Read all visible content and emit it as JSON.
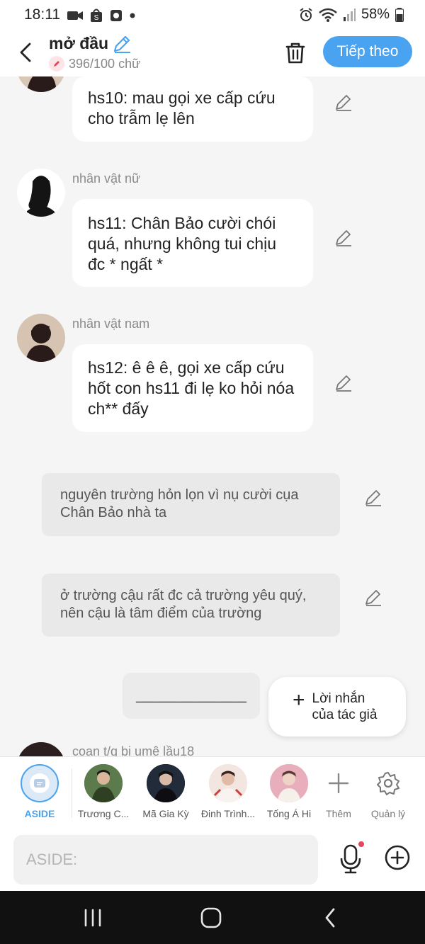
{
  "status_bar": {
    "time": "18:11",
    "battery": "58%"
  },
  "header": {
    "title": "mở đầu",
    "char_count": "396/100 chữ",
    "next_label": "Tiếp theo"
  },
  "messages": [
    {
      "speaker": "",
      "text": "hs10: mau gọi xe cấp cứu cho trẫm lẹ lên"
    },
    {
      "speaker": "nhân vật nữ",
      "text": "hs11: Chân Bảo cười chói quá, nhưng không tui chịu đc * ngất *"
    },
    {
      "speaker": "nhân vật nam",
      "text": "hs12: ê ê ê, gọi xe cấp cứu hốt con hs11 đi lẹ ko hỏi nóa ch** đấy"
    }
  ],
  "narrations": [
    {
      "text": "nguyên trường hỏn lọn vì nụ cười cụa Chân Bảo nhà ta"
    },
    {
      "text": "ở trường cậu rất đc cả trường yêu quý, nên cậu là tâm điểm của trường"
    }
  ],
  "blank_line": "______________",
  "author_note_label": "Lời nhắn của tác giả",
  "partial_speaker": "coan t/g bị umê lầu18",
  "characters": [
    {
      "name": "ASIDE",
      "active": true
    },
    {
      "name": "Trương C..."
    },
    {
      "name": "Mã Gia Kỳ"
    },
    {
      "name": "Đinh Trình..."
    },
    {
      "name": "Tống Á Hi"
    }
  ],
  "char_actions": {
    "add_label": "Thêm",
    "manage_label": "Quản lý"
  },
  "input": {
    "placeholder": "ASIDE:"
  },
  "colors": {
    "accent": "#4aa3f0",
    "background": "#f5f5f5"
  }
}
